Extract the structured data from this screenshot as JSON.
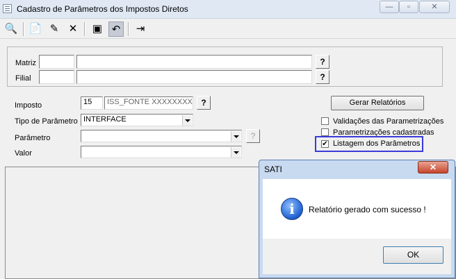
{
  "window": {
    "title": "Cadastro de Parâmetros dos Impostos Diretos",
    "minimize": "—",
    "maximize": "▫",
    "close": "✕"
  },
  "header": {
    "matriz_label": "Matriz",
    "filial_label": "Filial",
    "matriz_code": "",
    "matriz_name": "",
    "filial_code": "",
    "filial_name": "",
    "help": "?"
  },
  "form": {
    "imposto_label": "Imposto",
    "imposto_code": "15",
    "imposto_name": "ISS_FONTE XXXXXXXXXX",
    "tipo_label": "Tipo de Parâmetro",
    "tipo_value": "INTERFACE",
    "parametro_label": "Parâmetro",
    "parametro_value": "",
    "valor_label": "Valor",
    "valor_value": "",
    "help": "?"
  },
  "report": {
    "button": "Gerar Relatórios",
    "options": [
      {
        "label": "Validações das Parametrizações",
        "checked": false
      },
      {
        "label": "Parametrizações cadastradas",
        "checked": false
      },
      {
        "label": "Listagem dos Parâmetros",
        "checked": true
      }
    ],
    "check_mark": "✔"
  },
  "dialog": {
    "title": "SATI",
    "message": "Relatório gerado com sucesso !",
    "ok": "OK",
    "close": "✕",
    "info_glyph": "i"
  },
  "colors": {
    "highlight": "#3a3adc",
    "dialog_frame": "#c8daf0",
    "close_red": "#c7452c"
  }
}
